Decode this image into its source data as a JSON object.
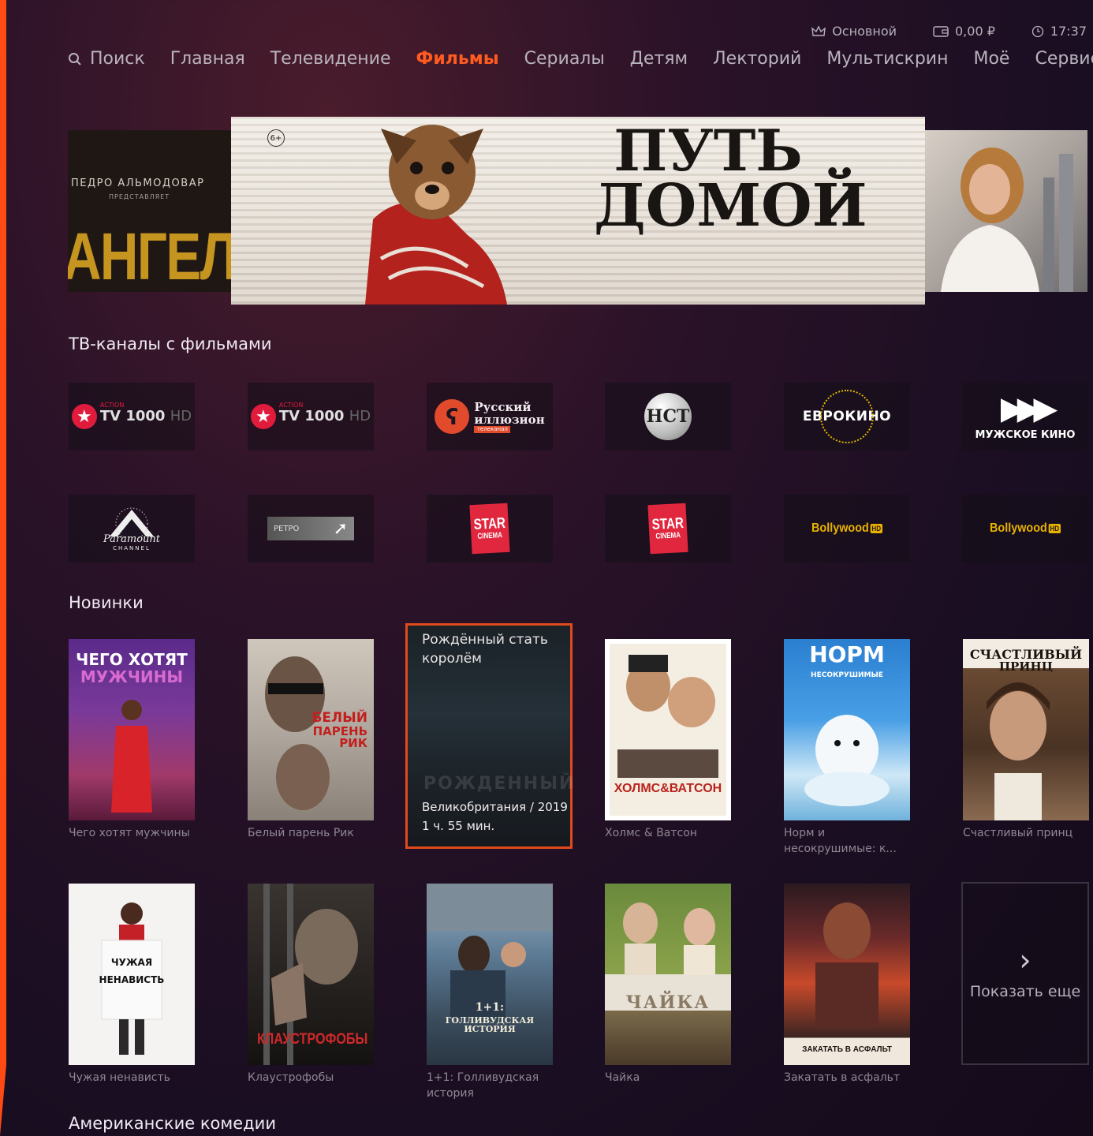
{
  "status": {
    "profile": "Основной",
    "balance": "0,00 ₽",
    "time": "17:37"
  },
  "nav": {
    "items": [
      "Поиск",
      "Главная",
      "Телевидение",
      "Фильмы",
      "Сериалы",
      "Детям",
      "Лекторий",
      "Мультискрин",
      "Моё",
      "Сервис"
    ],
    "active_index": 3
  },
  "hero": {
    "left_small": "ПЕДРО АЛЬМОДОВАР",
    "left_tiny": "ПРЕДСТАВЛЯЕТ",
    "left_big": "АНГЕЛ",
    "age": "6+",
    "title_line1": "ПУТЬ",
    "title_line2": "ДОМОЙ"
  },
  "tv_section": {
    "title": "ТВ-каналы с фильмами",
    "channels": [
      {
        "name": "TV1000 Action HD",
        "pre": "ACTION",
        "main": "TV 1000",
        "suffix": "HD"
      },
      {
        "name": "TV1000 Action HD",
        "pre": "ACTION",
        "main": "TV 1000",
        "suffix": "HD"
      },
      {
        "name": "Русский иллюзион",
        "line1": "Русский",
        "line2": "иллюзион",
        "tag": "телеканал"
      },
      {
        "name": "НСТ",
        "text": "НСТ"
      },
      {
        "name": "ЕВРОКИНО",
        "text": "ЕВРОКИНО"
      },
      {
        "name": "МУЖСКОЕ КИНО",
        "text": "МУЖСКОЕ КИНО"
      },
      {
        "name": "Paramount Channel",
        "script": "Paramount",
        "sub": "CHANNEL"
      },
      {
        "name": "РЕТРО",
        "text": "РЕТРО"
      },
      {
        "name": "STAR CINEMA",
        "l1": "STAR",
        "l2": "CINEMA"
      },
      {
        "name": "STAR CINEMA",
        "l1": "STAR",
        "l2": "CINEMA"
      },
      {
        "name": "Bollywood HD",
        "text": "Bollywood",
        "hd": "HD"
      },
      {
        "name": "Bollywood HD",
        "text": "Bollywood",
        "hd": "HD"
      }
    ]
  },
  "new_section": {
    "title": "Новинки",
    "row1": [
      {
        "caption": "Чего хотят мужчины",
        "poster_l1": "ЧЕГО ХОТЯТ",
        "poster_l2": "МУЖЧИНЫ"
      },
      {
        "caption": "Белый парень Рик",
        "poster_l1": "БЕЛЫЙ",
        "poster_l2": "ПАРЕНЬ РИК"
      },
      {
        "focused_title": "Рождённый стать королём",
        "watermark": "РОЖДЕННЫЙ",
        "meta_country_year": "Великобритания / 2019",
        "meta_duration": "1 ч. 55 мин."
      },
      {
        "caption": "Холмс & Ватсон",
        "poster_l1": "ХОЛМС&ВАТСОН"
      },
      {
        "caption": "Норм и несокрушимые: к...",
        "poster_l1": "НОРМ",
        "poster_l2": "НЕСОКРУШИМЫЕ"
      },
      {
        "caption": "Счастливый принц",
        "poster_l1": "СЧАСТЛИВЫЙ",
        "poster_l2": "ПРИНЦ"
      }
    ],
    "row2": [
      {
        "caption": "Чужая ненависть",
        "poster_l1": "ЧУЖАЯ",
        "poster_l2": "НЕНАВИСТЬ"
      },
      {
        "caption": "Клаустрофобы",
        "poster_l1": "КЛАУСТРОФОБЫ"
      },
      {
        "caption": "1+1: Голливудская история",
        "poster_l1": "1+1:",
        "poster_l2": "ГОЛЛИВУДСКАЯ ИСТОРИЯ"
      },
      {
        "caption": "Чайка",
        "poster_l1": "ЧАЙКА"
      },
      {
        "caption": "Закатать в асфальт",
        "poster_l1": "ЗАКАТАТЬ В АСФАЛЬТ"
      }
    ],
    "show_more": "Показать еще"
  },
  "next_section": {
    "title": "Американские комедии"
  },
  "colors": {
    "accent": "#ff5a1f",
    "focus_border": "#e04a1c"
  }
}
